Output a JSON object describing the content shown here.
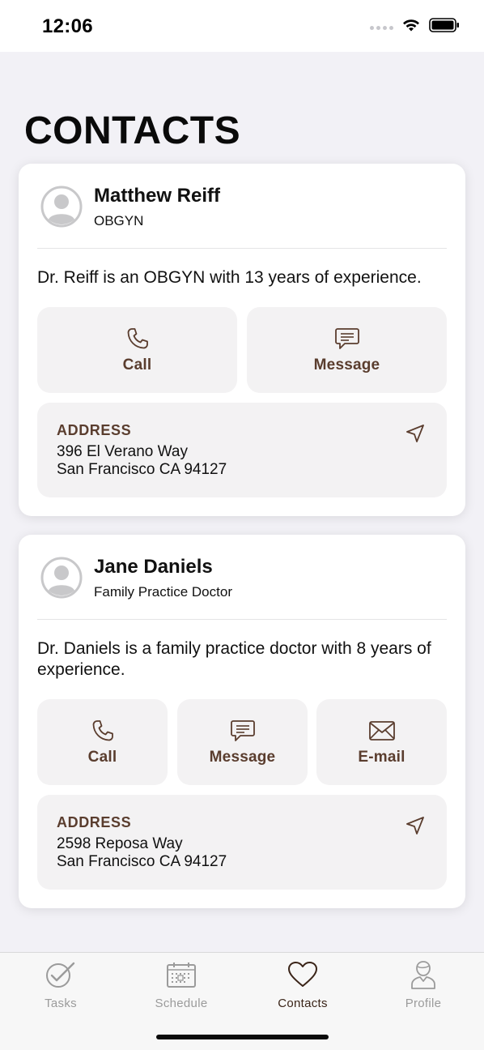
{
  "status_bar": {
    "time": "12:06"
  },
  "page": {
    "title": "CONTACTS"
  },
  "contacts": [
    {
      "name": "Matthew Reiff",
      "role": "OBGYN",
      "description": "Dr. Reiff is an OBGYN with 13 years of experience.",
      "actions": [
        {
          "label": "Call",
          "icon": "phone-icon"
        },
        {
          "label": "Message",
          "icon": "message-icon"
        }
      ],
      "address": {
        "label": "ADDRESS",
        "line1": "396 El Verano Way",
        "line2": "San Francisco CA 94127"
      }
    },
    {
      "name": "Jane Daniels",
      "role": "Family Practice Doctor",
      "description": "Dr. Daniels is a family practice doctor with 8 years of experience.",
      "actions": [
        {
          "label": "Call",
          "icon": "phone-icon"
        },
        {
          "label": "Message",
          "icon": "message-icon"
        },
        {
          "label": "E-mail",
          "icon": "mail-icon"
        }
      ],
      "address": {
        "label": "ADDRESS",
        "line1": "2598 Reposa Way",
        "line2": "San Francisco CA 94127"
      }
    }
  ],
  "tab_bar": {
    "items": [
      {
        "label": "Tasks",
        "icon": "tasks-check-icon",
        "active": false
      },
      {
        "label": "Schedule",
        "icon": "calendar-icon",
        "active": false
      },
      {
        "label": "Contacts",
        "icon": "heart-icon",
        "active": true
      },
      {
        "label": "Profile",
        "icon": "person-icon",
        "active": false
      }
    ]
  },
  "colors": {
    "accent": "#5a3d2e",
    "background": "#f2f1f6",
    "card": "#ffffff",
    "tile": "#f3f2f3",
    "inactive_tab": "#9b9b9b"
  }
}
